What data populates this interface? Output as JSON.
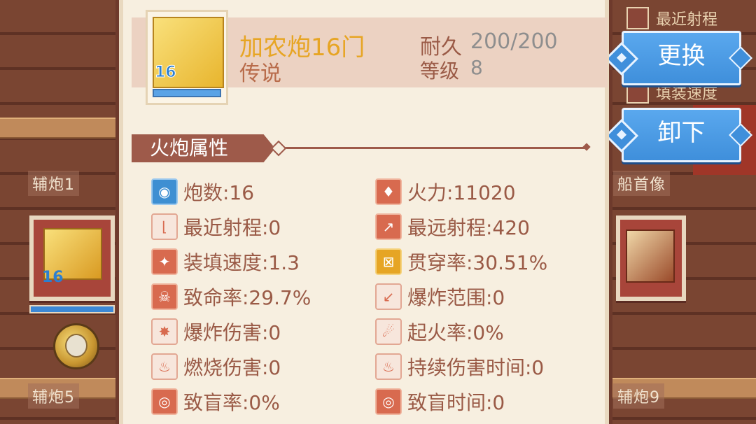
{
  "left_slots": [
    {
      "label": "辅炮1",
      "level": "16"
    },
    {
      "label": "辅炮5"
    }
  ],
  "right_slots": [
    {
      "label": "船首像"
    },
    {
      "label": "辅炮9"
    }
  ],
  "right_stats": [
    "最近射程",
    "填装速度"
  ],
  "actions": {
    "replace": "更换",
    "unload": "卸下"
  },
  "item": {
    "name": "加农炮16门",
    "rarity": "传说",
    "level_badge": "16",
    "durability_label": "耐久",
    "durability_value": "200/200",
    "level_label": "等级",
    "level_value": "8"
  },
  "section_title": "火炮属性",
  "attributes_left": [
    {
      "icon": "cannon-count-icon",
      "text": "炮数:16"
    },
    {
      "icon": "min-range-icon",
      "text": "最近射程:0"
    },
    {
      "icon": "reload-speed-icon",
      "text": "装填速度:1.3"
    },
    {
      "icon": "skull-icon",
      "text": "致命率:29.7%"
    },
    {
      "icon": "explosion-damage-icon",
      "text": "爆炸伤害:0"
    },
    {
      "icon": "burn-damage-icon",
      "text": "燃烧伤害:0"
    },
    {
      "icon": "blind-rate-icon",
      "text": "致盲率:0%"
    }
  ],
  "attributes_right": [
    {
      "icon": "firepower-icon",
      "text": "火力:11020"
    },
    {
      "icon": "max-range-icon",
      "text": "最远射程:420"
    },
    {
      "icon": "pierce-icon",
      "text": "贯穿率:30.51%"
    },
    {
      "icon": "blast-range-icon",
      "text": "爆炸范围:0"
    },
    {
      "icon": "ignite-icon",
      "text": "起火率:0%"
    },
    {
      "icon": "dot-duration-icon",
      "text": "持续伤害时间:0"
    },
    {
      "icon": "blind-duration-icon",
      "text": "致盲时间:0"
    }
  ]
}
